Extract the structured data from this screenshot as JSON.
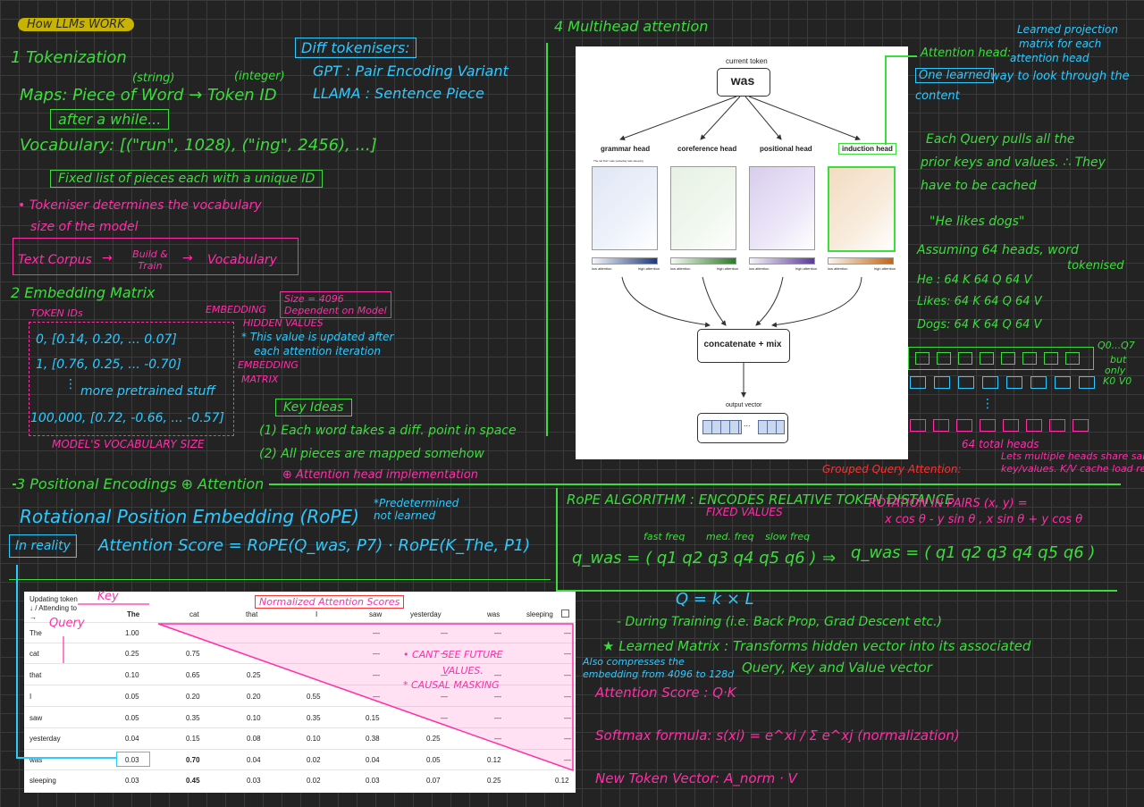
{
  "title": "How LLMs WORK",
  "s1": {
    "heading": "1 Tokenization",
    "string_label": "(string)",
    "integer_label": "(integer)",
    "maps": "Maps: Piece of Word → Token ID",
    "after_while": "after a while...",
    "vocabulary": "Vocabulary: [(\"run\", 1028), (\"ing\", 2456), ...]",
    "fixed_list": "Fixed list of pieces each with a unique ID",
    "tokeniser_note": "• Tokeniser determines the vocabulary",
    "tokeniser_note2": "size of the model",
    "flow_corpus": "Text Corpus",
    "flow_build": "Build & Train",
    "flow_vocab": "Vocabulary",
    "diff_heading": "Diff tokenisers:",
    "gpt": "GPT : Pair Encoding Variant",
    "llama": "LLAMA : Sentence Piece"
  },
  "s2": {
    "heading": "2 Embedding Matrix",
    "token_ids": "TOKEN IDs",
    "embedding_label": "EMBEDDING",
    "hidden_values": "HIDDEN VALUES",
    "size_note": "Size = 4096",
    "dependent": "Dependent on Model",
    "updated_note": "* This value is updated after",
    "updated_note2": "each attention iteration",
    "embedding_matrix": "EMBEDDING",
    "embedding_matrix2": "MATRIX",
    "row0": "0,  [0.14, 0.20, ... 0.07]",
    "row1": "1,  [0.76, 0.25, ... -0.70]",
    "pretrained": "more pretrained stuff",
    "row_last": "100,000,  [0.72, -0.66, ... -0.57]",
    "vocab_size": "MODEL'S VOCABULARY SIZE",
    "key_ideas": "Key Ideas",
    "idea1": "(1) Each word takes a diff. point in space",
    "idea2": "(2) All pieces are mapped somehow",
    "attention_impl": "⊕ Attention head implementation"
  },
  "s3": {
    "heading": "3 Positional Encodings ⊕ Attention",
    "rope_title": "Rotational Position Embedding (RoPE)",
    "predetermined": "*Predetermined not learned",
    "in_reality": "In reality",
    "formula": "Attention Score = RoPE(Q_was, P7) · RoPE(K_The, P1)",
    "rope_algo": "RoPE ALGORITHM : ENCODES RELATIVE TOKEN DISTANCE",
    "fixed_values": "FIXED VALUES",
    "rotation": "ROTATION IN PAIRS (x, y) =",
    "rotation_formula": "x cos θ - y sin θ ,  x sin θ + y cos θ",
    "fast_freq": "fast freq",
    "med_freq": "med. freq",
    "slow_freq": "slow freq",
    "q_was": "q_was = ( q1  q2  q3  q4  q5  q6 )",
    "q_was_rot": "q_was = ( q1  q2  q3  q4  q5  q6 )",
    "qkl": "Q = k × L",
    "training": "- During Training (i.e. Back Prop, Grad Descent etc.)",
    "learned": "★ Learned Matrix : Transforms hidden vector into its associated",
    "qkv": "Query, Key and Value vector",
    "compress": "Also compresses the",
    "compress2": "embedding from 4096 to 128d",
    "attn_score": "Attention Score : Q·K",
    "softmax": "Softmax formula:  s(xi) = e^xi / Σ e^xj   (normalization)",
    "new_token": "New Token Vector: A_norm · V"
  },
  "s4": {
    "heading": "4 Multihead attention",
    "attention_head": "Attention head:",
    "learned_proj": "Learned projection",
    "learned_proj2": "matrix for each",
    "learned_proj3": "attention head",
    "one_learned": "One learned",
    "one_learned2": "way to look through the",
    "one_learned3": "content",
    "each_query": "Each Query pulls all the",
    "each_query2": "prior keys and values. ∴ They",
    "each_query3": "have to be cached",
    "quote": "\"He likes dogs\"",
    "assuming": "Assuming 64 heads, word",
    "tokenised": "tokenised",
    "he": "He : 64 K  64 Q  64 V",
    "likes": "Likes: 64 K  64 Q  64 V",
    "dogs": "Dogs: 64 K  64 Q  64 V",
    "q_label": "Q0...Q7",
    "but_only": "but",
    "but_only2": "only",
    "kv": "K0 V0",
    "total_heads": "64 total heads",
    "gqa": "Grouped Query Attention:",
    "gqa_note": "Lets multiple heads share same",
    "gqa_note2": "key/values. K/V cache load reduction"
  },
  "figure": {
    "current_token": "current token",
    "token": "was",
    "heads": [
      "grammar head",
      "coreference head",
      "positional head",
      "induction head"
    ],
    "low": "low attention",
    "high": "high attention",
    "concat": "concatenate + mix",
    "output": "output vector",
    "dots": "...",
    "tiny_words": "The  cat  that  I  saw  yesterday  was  sleeping"
  },
  "table": {
    "header_line1": "Updating token",
    "header_line2": "↓ / Attending to",
    "header_arrow": "→",
    "columns": [
      "The",
      "cat",
      "that",
      "I",
      "saw",
      "yesterday",
      "was",
      "sleeping"
    ],
    "rows": [
      {
        "label": "The",
        "values": [
          "1.00",
          "",
          "",
          "",
          "—",
          "—",
          "—",
          "—"
        ]
      },
      {
        "label": "cat",
        "values": [
          "0.25",
          "0.75",
          "",
          "",
          "—",
          "—",
          "—",
          "—"
        ]
      },
      {
        "label": "that",
        "values": [
          "0.10",
          "0.65",
          "0.25",
          "",
          "—",
          "—",
          "—",
          "—"
        ]
      },
      {
        "label": "I",
        "values": [
          "0.05",
          "0.20",
          "0.20",
          "0.55",
          "—",
          "—",
          "—",
          "—"
        ]
      },
      {
        "label": "saw",
        "values": [
          "0.05",
          "0.35",
          "0.10",
          "0.35",
          "0.15",
          "—",
          "—",
          "—"
        ]
      },
      {
        "label": "yesterday",
        "values": [
          "0.04",
          "0.15",
          "0.08",
          "0.10",
          "0.38",
          "0.25",
          "—",
          "—"
        ]
      },
      {
        "label": "was",
        "values": [
          "0.03",
          "0.70",
          "0.04",
          "0.02",
          "0.04",
          "0.05",
          "0.12",
          "—"
        ]
      },
      {
        "label": "sleeping",
        "values": [
          "0.03",
          "0.45",
          "0.03",
          "0.02",
          "0.03",
          "0.07",
          "0.25",
          "0.12"
        ]
      }
    ],
    "key": "Key",
    "query": "Query",
    "normalized": "Normalized Attention Scores",
    "cant_see": "• CANT SEE FUTURE",
    "cant_see2": "VALUES.",
    "causal": "* CAUSAL MASKING"
  }
}
